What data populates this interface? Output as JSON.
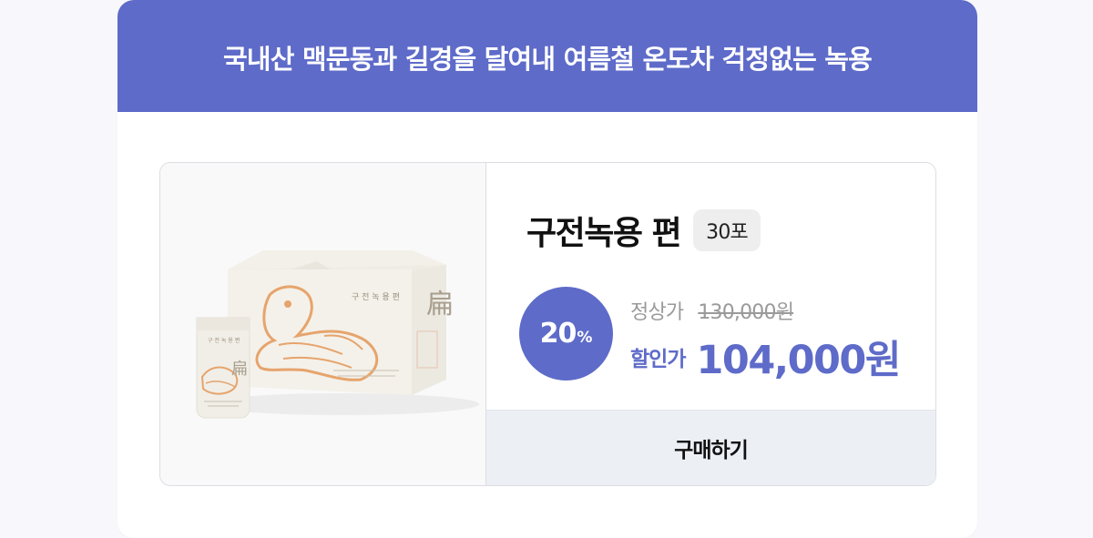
{
  "banner": {
    "text": "국내산 맥문동과 길경을 달여내 여름철 온도차 걱정없는 녹용"
  },
  "product": {
    "name": "구전녹용 편",
    "pack_count": "30포",
    "discount": {
      "percent_number": "20",
      "percent_sign": "%"
    },
    "original_price_label": "정상가",
    "original_price": "130,000원",
    "sale_price_label": "할인가",
    "sale_price": "104,000원",
    "buy_label": "구매하기",
    "package_text": {
      "box_title": "구 전 녹 용 편",
      "pouch_title": "구 전 녹 용 편",
      "box_char": "扁",
      "pouch_char": "扁"
    }
  },
  "colors": {
    "accent": "#5e6bc9",
    "buy_button_bg": "#ecf0f5",
    "badge_bg": "#eeeeee"
  }
}
